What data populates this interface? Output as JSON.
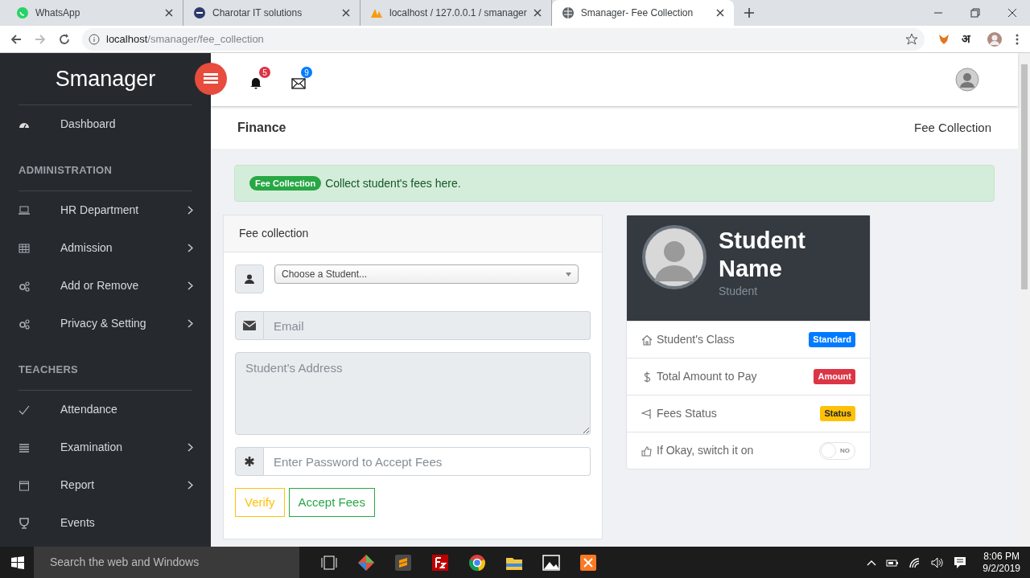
{
  "browser": {
    "tabs": [
      {
        "title": "WhatsApp",
        "selected": false
      },
      {
        "title": "Charotar IT solutions",
        "selected": false
      },
      {
        "title": "localhost / 127.0.0.1 / smanager",
        "selected": false
      },
      {
        "title": "Smanager- Fee Collection",
        "selected": true
      }
    ],
    "address": {
      "host": "localhost",
      "path": "/smanager/fee_collection"
    },
    "extension_label": "अ"
  },
  "sidebar": {
    "brand": "Smanager",
    "items": [
      {
        "kind": "link",
        "label": "Dashboard",
        "submenu": false
      },
      {
        "kind": "heading",
        "label": "ADMINISTRATION"
      },
      {
        "kind": "link",
        "label": "HR Department",
        "submenu": true
      },
      {
        "kind": "link",
        "label": "Admission",
        "submenu": true
      },
      {
        "kind": "link",
        "label": "Add or Remove",
        "submenu": true
      },
      {
        "kind": "link",
        "label": "Privacy & Setting",
        "submenu": true
      },
      {
        "kind": "heading",
        "label": "TEACHERS"
      },
      {
        "kind": "link",
        "label": "Attendance",
        "submenu": false
      },
      {
        "kind": "link",
        "label": "Examination",
        "submenu": true
      },
      {
        "kind": "link",
        "label": "Report",
        "submenu": true
      },
      {
        "kind": "link",
        "label": "Events",
        "submenu": false
      }
    ]
  },
  "header": {
    "notifications": "5",
    "messages": "9"
  },
  "breadcrumb": {
    "section": "Finance",
    "page": "Fee Collection"
  },
  "alert": {
    "badge": "Fee Collection",
    "text": "Collect student's fees here."
  },
  "form": {
    "title": "Fee collection",
    "student_select": {
      "placeholder": "Choose a Student..."
    },
    "email": {
      "placeholder": "Email"
    },
    "address": {
      "placeholder": "Student's Address"
    },
    "password": {
      "placeholder": "Enter Password to Accept Fees"
    },
    "buttons": [
      {
        "label": "Verify",
        "kind": "warning"
      },
      {
        "label": "Accept Fees",
        "kind": "success"
      }
    ]
  },
  "profile": {
    "name": "Student Name",
    "role": "Student",
    "rows": [
      {
        "kind": "badge",
        "label": "Student's Class",
        "badge": "Standard",
        "color": "#007bff"
      },
      {
        "kind": "badge",
        "label": "Total Amount to Pay",
        "badge": "Amount",
        "color": "#dc3545"
      },
      {
        "kind": "badge",
        "label": "Fees Status",
        "badge": "Status",
        "color": "#ffc107"
      },
      {
        "kind": "switch",
        "label": "If Okay, switch it on",
        "on": false,
        "switch_label": "NO"
      }
    ]
  },
  "taskbar": {
    "search": "Search the web and Windows",
    "time": "8:06 PM",
    "date": "9/2/2019"
  }
}
